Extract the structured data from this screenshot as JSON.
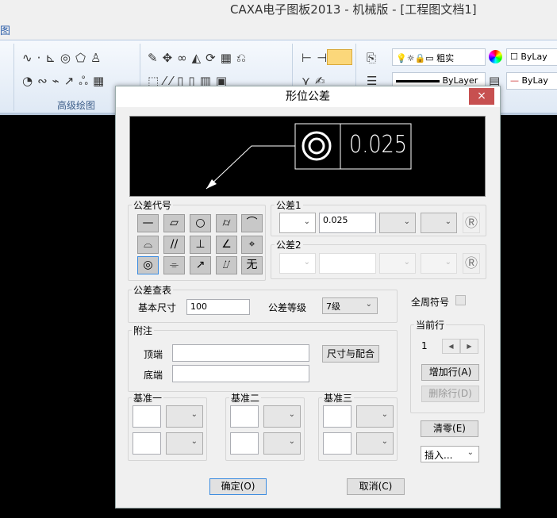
{
  "app": {
    "title": "CAXA电子图板2013 - 机械版 - [工程图文档1]",
    "menu_partial": "图"
  },
  "ribbon": {
    "group_label": "高级绘图",
    "linetype_label": "粗实",
    "color_label": "ByLay",
    "lineweight_label": "ByLayer",
    "linestyle_label": "ByLay"
  },
  "dialog": {
    "title": "形位公差",
    "close": "×",
    "preview": {
      "value": "0.025",
      "symbol": "concentricity"
    },
    "symbols_group": {
      "label": "公差代号",
      "symbols": [
        "—",
        "▱",
        "○",
        "⌭",
        "⌒",
        "⌓",
        "//",
        "⊥",
        "∠",
        "⌖",
        "◎",
        "⌯",
        "↗",
        "⌰",
        "无"
      ],
      "selected_index": 10
    },
    "tol1": {
      "label": "公差1",
      "value": "0.025",
      "r": "Ⓡ"
    },
    "tol2": {
      "label": "公差2",
      "value": "",
      "r": "Ⓡ"
    },
    "lookup": {
      "label": "公差查表",
      "basic_size_label": "基本尺寸",
      "basic_size": "100",
      "grade_label": "公差等级",
      "grade": "7级"
    },
    "all_around": {
      "label": "全周符号",
      "checked": false
    },
    "current_row": {
      "label": "当前行",
      "value": "1",
      "add": "增加行(A)",
      "delete": "删除行(D)"
    },
    "clear": "清零(E)",
    "insert": "插入...",
    "notes": {
      "label": "附注",
      "top_label": "顶端",
      "top_value": "",
      "bottom_label": "底端",
      "bottom_value": "",
      "fit_button": "尺寸与配合"
    },
    "datums": [
      {
        "label": "基准一"
      },
      {
        "label": "基准二"
      },
      {
        "label": "基准三"
      }
    ],
    "ok": "确定(O)",
    "cancel": "取消(C)"
  }
}
